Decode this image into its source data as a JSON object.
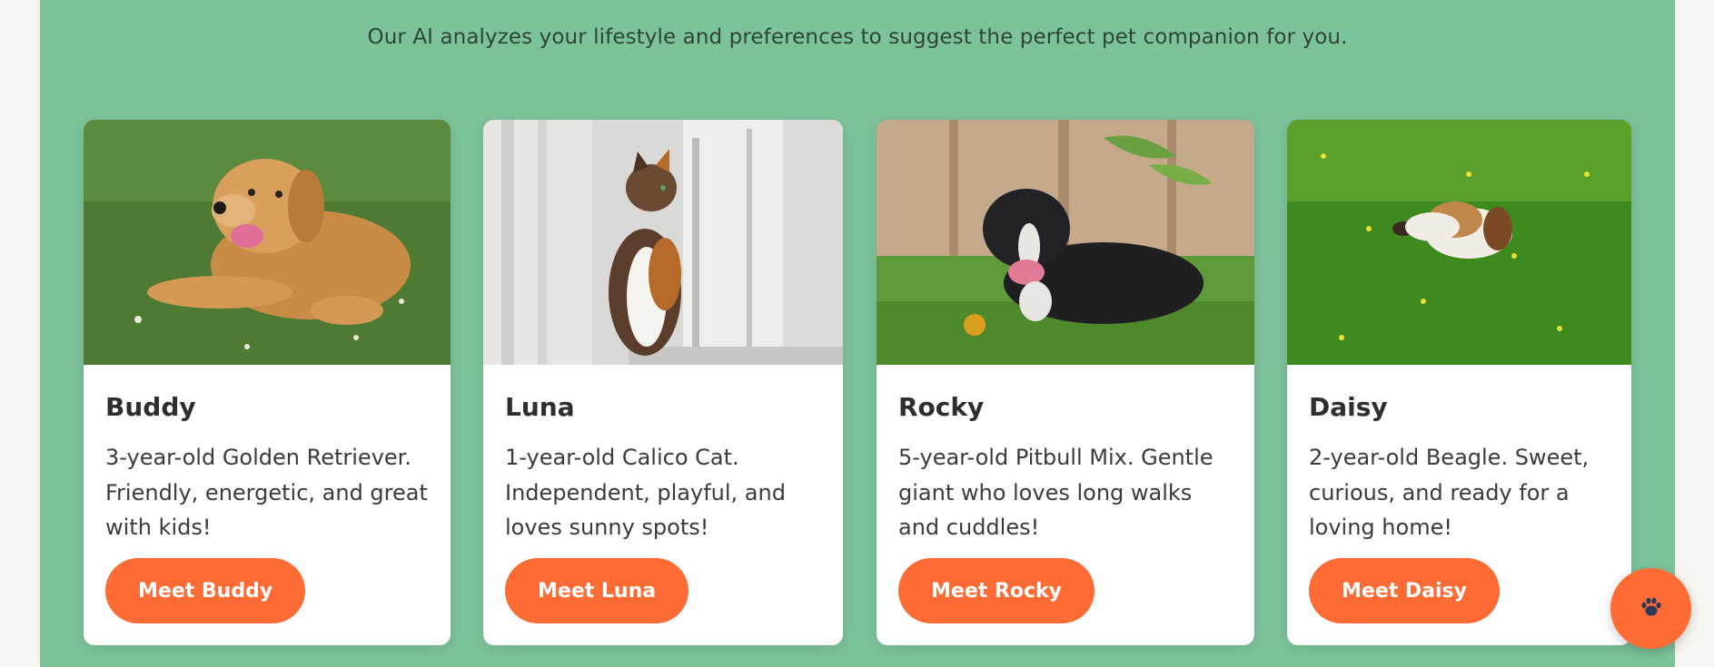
{
  "tagline": "Our AI analyzes your lifestyle and preferences to suggest the perfect pet companion for you.",
  "pets": [
    {
      "name": "Buddy",
      "description": "3-year-old Golden Retriever. Friendly, energetic, and great with kids!",
      "button": "Meet Buddy"
    },
    {
      "name": "Luna",
      "description": "1-year-old Calico Cat. Independent, playful, and loves sunny spots!",
      "button": "Meet Luna"
    },
    {
      "name": "Rocky",
      "description": "5-year-old Pitbull Mix. Gentle giant who loves long walks and cuddles!",
      "button": "Meet Rocky"
    },
    {
      "name": "Daisy",
      "description": "2-year-old Beagle. Sweet, curious, and ready for a loving home!",
      "button": "Meet Daisy"
    }
  ],
  "fab": {
    "icon": "paw-icon"
  },
  "colors": {
    "section_bg": "#7cc29a",
    "accent": "#ff6b35",
    "card_bg": "#ffffff",
    "page_bg": "#f7f6f2"
  }
}
